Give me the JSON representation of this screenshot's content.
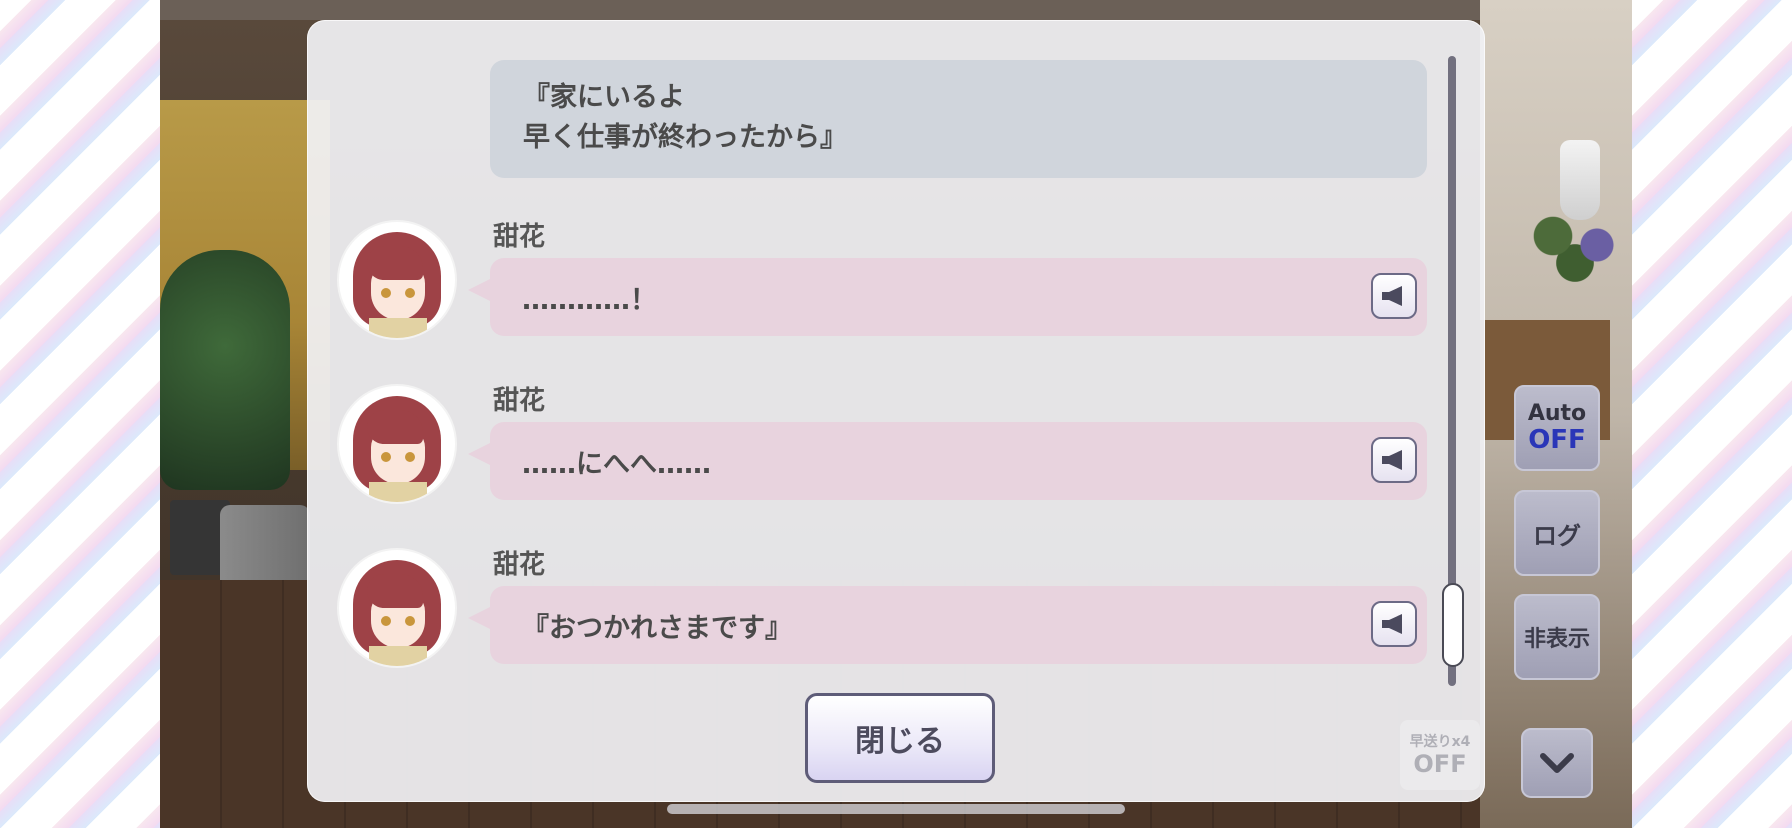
{
  "log": {
    "entries": [
      {
        "speaker": "",
        "lines": [
          "『家にいるよ",
          "早く仕事が終わったから』"
        ]
      },
      {
        "speaker": "甜花",
        "lines": [
          "…………！"
        ]
      },
      {
        "speaker": "甜花",
        "lines": [
          "……にへへ……"
        ]
      },
      {
        "speaker": "甜花",
        "lines": [
          "『おつかれさまです』"
        ]
      }
    ],
    "close_label": "閉じる"
  },
  "controls": {
    "auto_label": "Auto",
    "auto_state": "OFF",
    "log_label": "ログ",
    "hide_label": "非表示",
    "skip_label": "早送りx4",
    "skip_state": "OFF"
  },
  "icons": {
    "voice": "speaker-icon",
    "down": "chevron-down-icon"
  },
  "colors": {
    "narration_bubble": "#d0d5dc",
    "speech_bubble": "#e8d3de",
    "auto_off": "#2a36b8"
  }
}
